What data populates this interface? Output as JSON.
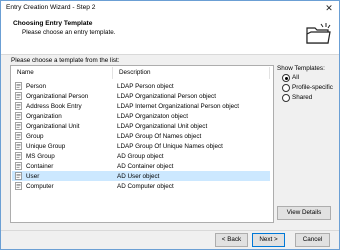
{
  "window": {
    "title": "Entry Creation Wizard - Step 2",
    "close_glyph": "✕"
  },
  "header": {
    "title": "Choosing Entry Template",
    "subtitle": "Please choose an entry template."
  },
  "list_prompt": "Please choose a template from the list:",
  "columns": {
    "name": "Name",
    "description": "Description"
  },
  "templates": [
    {
      "name": "Person",
      "description": "LDAP Person object"
    },
    {
      "name": "Organizational Person",
      "description": "LDAP Organizational Person object"
    },
    {
      "name": "Address Book Entry",
      "description": "LDAP Internet Organizational Person object"
    },
    {
      "name": "Organization",
      "description": "LDAP Organizaton object"
    },
    {
      "name": "Organizational Unit",
      "description": "LDAP Organizational Unit object"
    },
    {
      "name": "Group",
      "description": "LDAP Group Of Names object"
    },
    {
      "name": "Unique Group",
      "description": "LDAP Group Of Unique Names object"
    },
    {
      "name": "MS Group",
      "description": "AD Group object"
    },
    {
      "name": "Container",
      "description": "AD Container object"
    },
    {
      "name": "User",
      "description": "AD User object"
    },
    {
      "name": "Computer",
      "description": "AD Computer object"
    }
  ],
  "selected_template": "User",
  "show_templates": {
    "label": "Show Templates:",
    "options": [
      "All",
      "Profile-specific",
      "Shared"
    ],
    "selected": "All"
  },
  "buttons": {
    "view_details": "View Details",
    "back": "< Back",
    "next": "Next >",
    "cancel": "Cancel"
  },
  "colors": {
    "selection": "#cce8ff",
    "accent": "#0078d7"
  }
}
